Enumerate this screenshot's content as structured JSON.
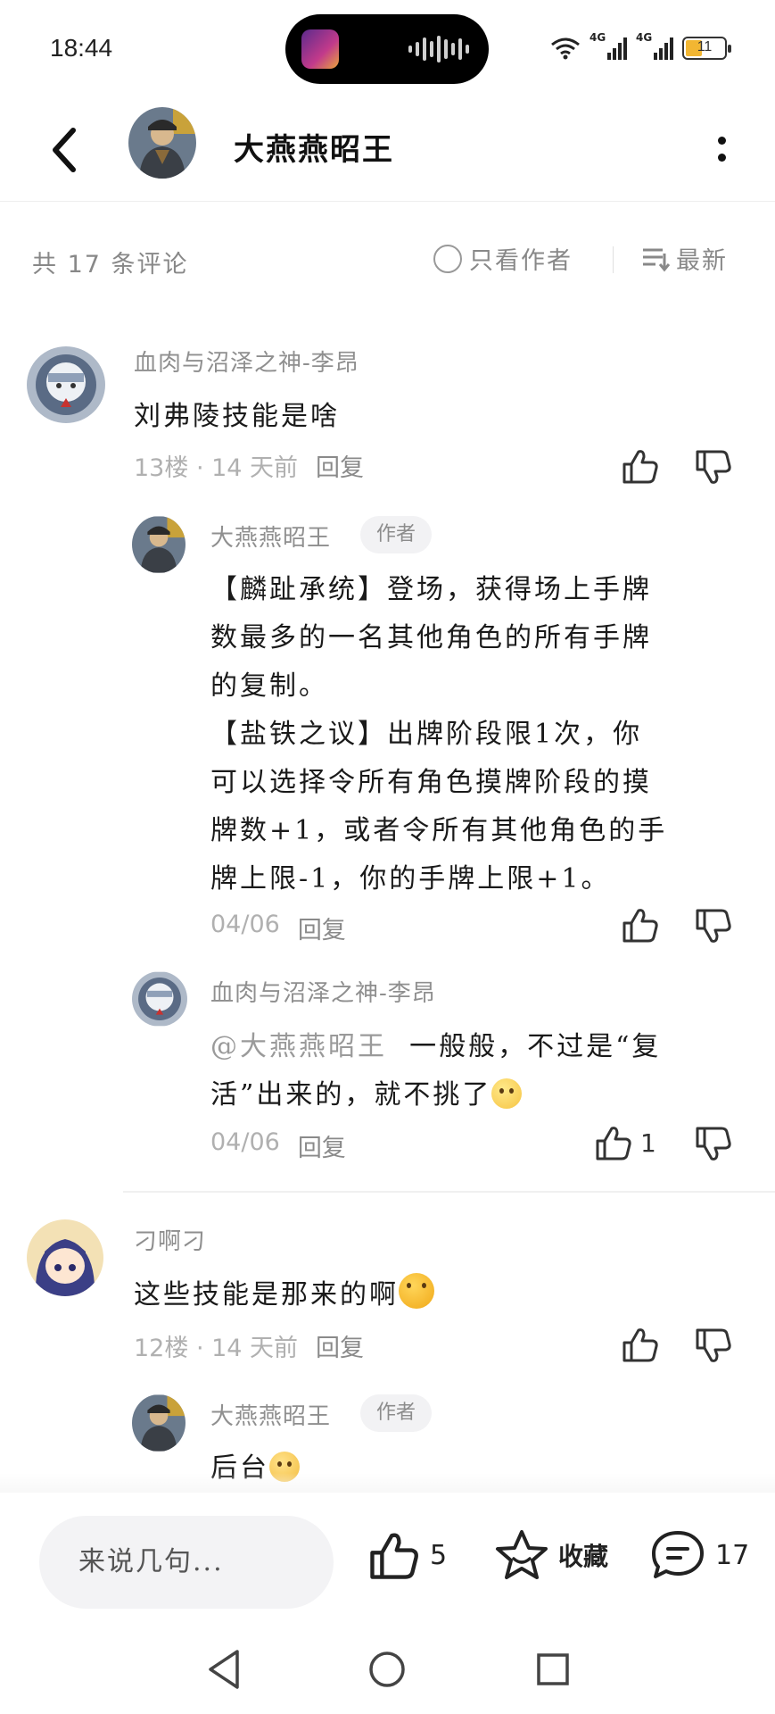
{
  "status_bar": {
    "time": "18:44",
    "network1": "4G",
    "network2": "4G",
    "battery": "11"
  },
  "header": {
    "title": "大燕燕昭王"
  },
  "filter": {
    "count_label": "共 17 条评论",
    "author_only_label": "只看作者",
    "sort_label": "最新"
  },
  "comments": [
    {
      "user": "血肉与沼泽之神-李昂",
      "text": "刘弗陵技能是啥",
      "floor": "13楼 · 14 天前",
      "reply_label": "回复",
      "replies": [
        {
          "user": "大燕燕昭王",
          "tag": "作者",
          "lines": [
            "【麟趾承统】登场，获得场上手牌",
            "数最多的一名其他角色的所有手牌",
            "的复制。",
            "【盐铁之议】出牌阶段限1次，你",
            "可以选择令所有角色摸牌阶段的摸",
            "牌数+1，或者令所有其他角色的手",
            "牌上限-1，你的手牌上限+1。"
          ],
          "date": "04/06",
          "reply_label": "回复"
        },
        {
          "user": "血肉与沼泽之神-李昂",
          "mention": "@大燕燕昭王",
          "line1": "一般般，不过是“复",
          "line2": "活”出来的，就不挑了",
          "emoji": "sweat-smile-emoji",
          "date": "04/06",
          "reply_label": "回复",
          "likes": "1"
        }
      ]
    },
    {
      "user": "刁啊刁",
      "text": "这些技能是那来的啊",
      "emoji": "frown-emoji",
      "floor": "12楼 · 14 天前",
      "reply_label": "回复",
      "replies": [
        {
          "user": "大燕燕昭王",
          "tag": "作者",
          "text": "后台",
          "emoji": "grin-emoji"
        }
      ]
    }
  ],
  "bottom_bar": {
    "input_placeholder": "来说几句...",
    "likes": "5",
    "favorite_label": "收藏",
    "comments": "17"
  },
  "colors": {
    "text": "#1a1a1a",
    "muted": "#8f8f8f",
    "light": "#b0b0b0",
    "tag_bg": "#f2f2f4",
    "input_bg": "#f3f3f5"
  }
}
